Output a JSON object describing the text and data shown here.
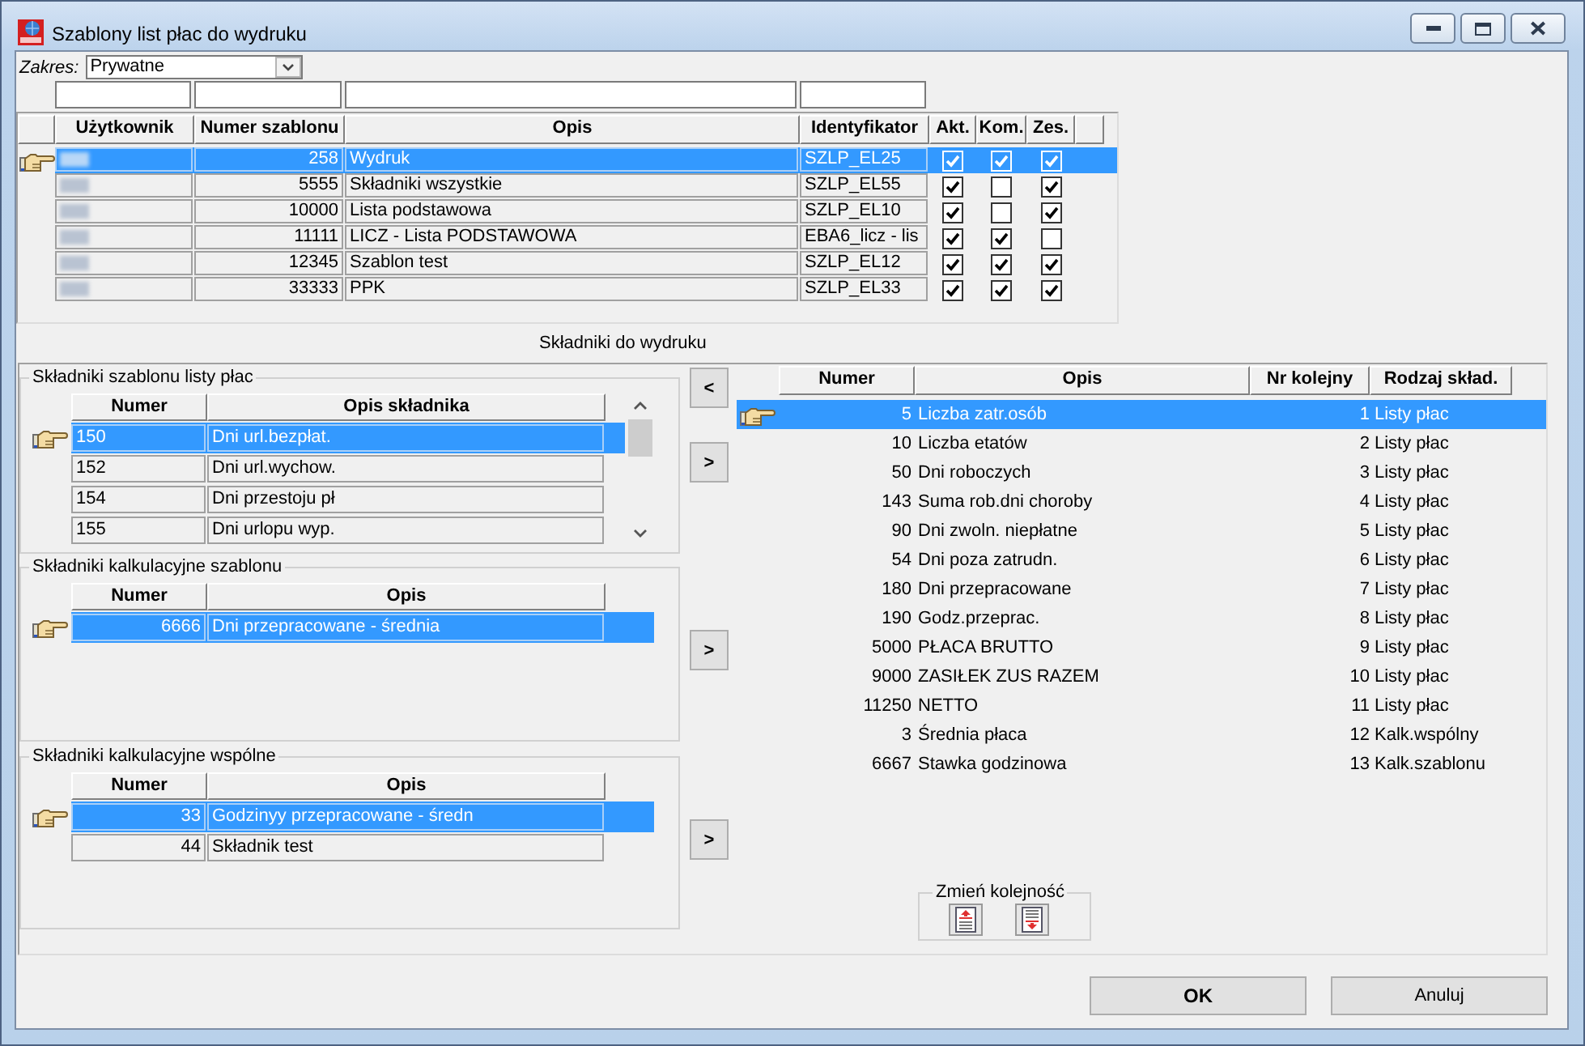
{
  "window": {
    "title": "Szablony list płac do wydruku"
  },
  "scope": {
    "label": "Zakres:",
    "value": "Prywatne"
  },
  "templates": {
    "columns": [
      {
        "label": "Użytkownik",
        "filter": true
      },
      {
        "label": "Numer szablonu",
        "filter": true
      },
      {
        "label": "Opis",
        "filter": true
      },
      {
        "label": "Identyfikator",
        "filter": true
      },
      {
        "label": "Akt.",
        "filter": false
      },
      {
        "label": "Kom.",
        "filter": false
      },
      {
        "label": "Zes.",
        "filter": false
      }
    ],
    "rows": [
      {
        "selected": true,
        "number": "258",
        "description": "Wydruk",
        "identifier": "SZLP_EL25",
        "flags": [
          {
            "checked": true
          },
          {
            "checked": true
          },
          {
            "checked": true
          }
        ]
      },
      {
        "selected": false,
        "number": "5555",
        "description": "Składniki wszystkie",
        "identifier": "SZLP_EL55",
        "flags": [
          {
            "checked": true
          },
          {
            "checked": false
          },
          {
            "checked": true
          }
        ]
      },
      {
        "selected": false,
        "number": "10000",
        "description": "Lista podstawowa",
        "identifier": "SZLP_EL10",
        "flags": [
          {
            "checked": true
          },
          {
            "checked": false
          },
          {
            "checked": true
          }
        ]
      },
      {
        "selected": false,
        "number": "11111",
        "description": "LICZ - Lista PODSTAWOWA",
        "identifier": "EBA6_licz - lis",
        "flags": [
          {
            "checked": true
          },
          {
            "checked": true
          },
          {
            "checked": false
          }
        ]
      },
      {
        "selected": false,
        "number": "12345",
        "description": "Szablon test",
        "identifier": "SZLP_EL12",
        "flags": [
          {
            "checked": true
          },
          {
            "checked": true
          },
          {
            "checked": true
          }
        ]
      },
      {
        "selected": false,
        "number": "33333",
        "description": "PPK",
        "identifier": "SZLP_EL33",
        "flags": [
          {
            "checked": true
          },
          {
            "checked": true
          },
          {
            "checked": true
          }
        ]
      }
    ]
  },
  "section_title": "Składniki do wydruku",
  "groups": [
    {
      "title": "Składniki szablonu listy płac",
      "kind": "scrollable",
      "columns": [
        "Numer",
        "Opis składnika"
      ],
      "buttons": [
        "<",
        ">"
      ],
      "rows": [
        {
          "number": "150",
          "description": "Dni url.bezpłat.",
          "selected": true
        },
        {
          "number": "152",
          "description": "Dni url.wychow.",
          "selected": false
        },
        {
          "number": "154",
          "description": "Dni przestoju pł",
          "selected": false
        },
        {
          "number": "155",
          "description": "Dni urlopu wyp.",
          "selected": false
        }
      ]
    },
    {
      "title": "Składniki kalkulacyjne szablonu",
      "kind": "plain",
      "columns": [
        "Numer",
        "Opis"
      ],
      "buttons": [
        ">"
      ],
      "rows": [
        {
          "number": "6666",
          "description": "Dni przepracowane - średnia",
          "selected": true
        }
      ]
    },
    {
      "title": "Składniki kalkulacyjne wspólne",
      "kind": "plain",
      "columns": [
        "Numer",
        "Opis"
      ],
      "buttons": [
        ">"
      ],
      "rows": [
        {
          "number": "33",
          "description": "Godzinyy przepracowane - średn",
          "selected": true
        },
        {
          "number": "44",
          "description": "Składnik test",
          "selected": false
        }
      ]
    }
  ],
  "print_items": {
    "columns": [
      "Numer",
      "Opis",
      "Nr kolejny",
      "Rodzaj skład."
    ],
    "rows": [
      {
        "number": "5",
        "description": "Liczba zatr.osób",
        "order": "1",
        "type": "Listy płac",
        "selected": true
      },
      {
        "number": "10",
        "description": "Liczba etatów",
        "order": "2",
        "type": "Listy płac",
        "selected": false
      },
      {
        "number": "50",
        "description": "Dni roboczych",
        "order": "3",
        "type": "Listy płac",
        "selected": false
      },
      {
        "number": "143",
        "description": "Suma rob.dni choroby",
        "order": "4",
        "type": "Listy płac",
        "selected": false
      },
      {
        "number": "90",
        "description": "Dni zwoln. niepłatne",
        "order": "5",
        "type": "Listy płac",
        "selected": false
      },
      {
        "number": "54",
        "description": "Dni poza zatrudn.",
        "order": "6",
        "type": "Listy płac",
        "selected": false
      },
      {
        "number": "180",
        "description": "Dni przepracowane",
        "order": "7",
        "type": "Listy płac",
        "selected": false
      },
      {
        "number": "190",
        "description": "Godz.przeprac.",
        "order": "8",
        "type": "Listy płac",
        "selected": false
      },
      {
        "number": "5000",
        "description": "PŁACA BRUTTO",
        "order": "9",
        "type": "Listy płac",
        "selected": false
      },
      {
        "number": "9000",
        "description": "ZASIŁEK ZUS RAZEM",
        "order": "10",
        "type": "Listy płac",
        "selected": false
      },
      {
        "number": "11250",
        "description": "NETTO",
        "order": "11",
        "type": "Listy płac",
        "selected": false
      },
      {
        "number": "3",
        "description": "Średnia płaca",
        "order": "12",
        "type": "Kalk.wspólny",
        "selected": false
      },
      {
        "number": "6667",
        "description": "Stawka godzinowa",
        "order": "13",
        "type": "Kalk.szablonu",
        "selected": false
      }
    ]
  },
  "reorder": {
    "label": "Zmień kolejność"
  },
  "buttons": [
    {
      "label": "OK",
      "default": true
    },
    {
      "label": "Anuluj",
      "default": false
    }
  ]
}
